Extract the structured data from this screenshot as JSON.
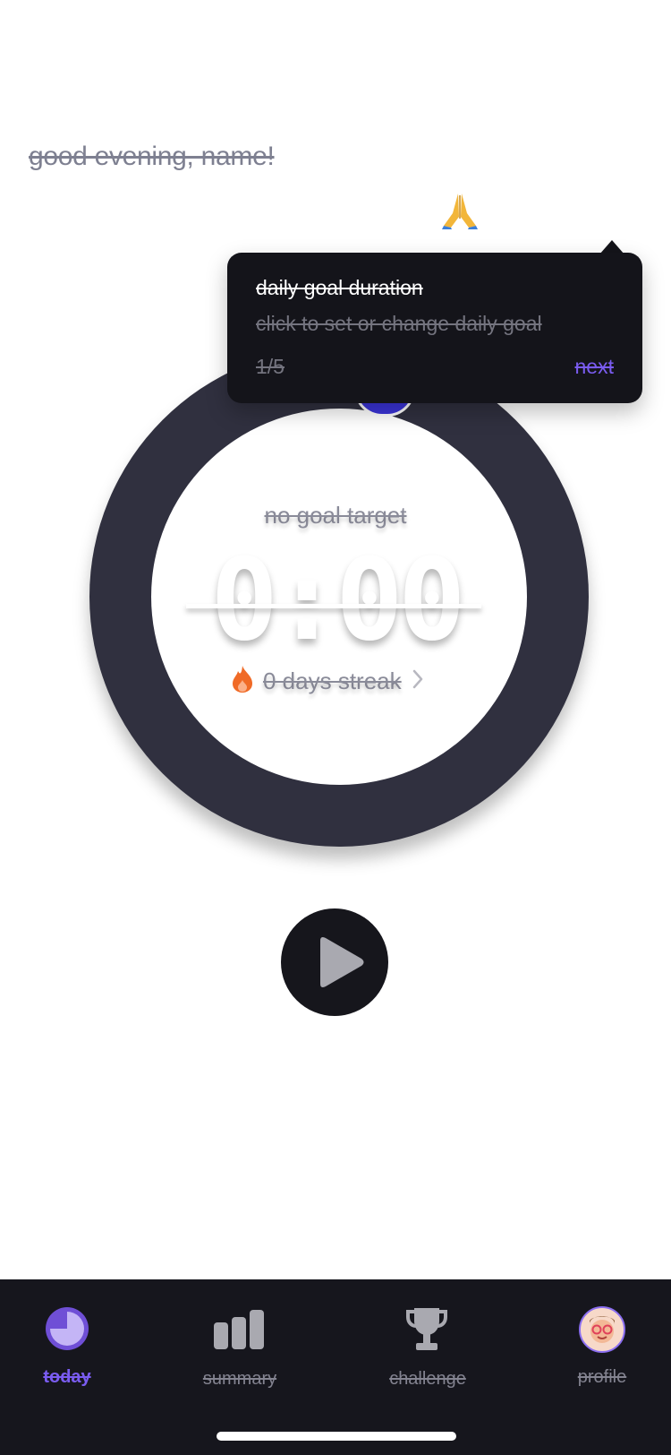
{
  "greeting": "good evening, name!",
  "header": {
    "emoji": "🙏"
  },
  "timer": {
    "goal_label": "no goal target",
    "time": "0:00",
    "streak_label": "0 days streak",
    "ring_color": "#30303f",
    "knob_color": "#3b34d9"
  },
  "tooltip": {
    "title": "daily goal duration",
    "description": "click to set or change daily goal",
    "step": "1/5",
    "next_label": "next"
  },
  "colors": {
    "accent": "#7a5cf0",
    "tab_bar": "#16161d",
    "streak_fire": "#f06a26"
  },
  "tabs": [
    {
      "label": "today",
      "icon": "pie-chart-icon",
      "active": true
    },
    {
      "label": "summary",
      "icon": "bar-chart-icon",
      "active": false
    },
    {
      "label": "challenge",
      "icon": "trophy-icon",
      "active": false
    },
    {
      "label": "profile",
      "icon": "avatar-icon",
      "active": false
    }
  ]
}
